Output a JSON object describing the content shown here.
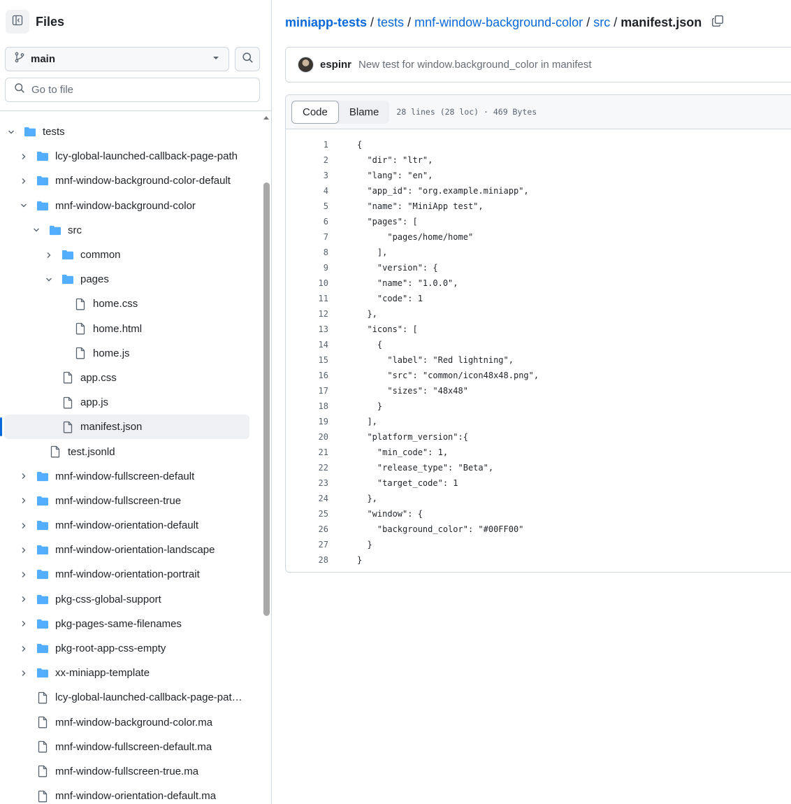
{
  "sidebar": {
    "title": "Files",
    "branch": "main",
    "goto_placeholder": "Go to file",
    "tree": [
      {
        "name": "tests",
        "type": "folder",
        "depth": 0,
        "expanded": true
      },
      {
        "name": "lcy-global-launched-callback-page-path",
        "type": "folder",
        "depth": 1,
        "expanded": false
      },
      {
        "name": "mnf-window-background-color-default",
        "type": "folder",
        "depth": 1,
        "expanded": false
      },
      {
        "name": "mnf-window-background-color",
        "type": "folder",
        "depth": 1,
        "expanded": true
      },
      {
        "name": "src",
        "type": "folder",
        "depth": 2,
        "expanded": true
      },
      {
        "name": "common",
        "type": "folder",
        "depth": 3,
        "expanded": false
      },
      {
        "name": "pages",
        "type": "folder",
        "depth": 3,
        "expanded": true
      },
      {
        "name": "home.css",
        "type": "file",
        "depth": 4
      },
      {
        "name": "home.html",
        "type": "file",
        "depth": 4
      },
      {
        "name": "home.js",
        "type": "file",
        "depth": 4
      },
      {
        "name": "app.css",
        "type": "file",
        "depth": 3
      },
      {
        "name": "app.js",
        "type": "file",
        "depth": 3
      },
      {
        "name": "manifest.json",
        "type": "file",
        "depth": 3,
        "active": true
      },
      {
        "name": "test.jsonld",
        "type": "file",
        "depth": 2
      },
      {
        "name": "mnf-window-fullscreen-default",
        "type": "folder",
        "depth": 1,
        "expanded": false
      },
      {
        "name": "mnf-window-fullscreen-true",
        "type": "folder",
        "depth": 1,
        "expanded": false
      },
      {
        "name": "mnf-window-orientation-default",
        "type": "folder",
        "depth": 1,
        "expanded": false
      },
      {
        "name": "mnf-window-orientation-landscape",
        "type": "folder",
        "depth": 1,
        "expanded": false
      },
      {
        "name": "mnf-window-orientation-portrait",
        "type": "folder",
        "depth": 1,
        "expanded": false
      },
      {
        "name": "pkg-css-global-support",
        "type": "folder",
        "depth": 1,
        "expanded": false
      },
      {
        "name": "pkg-pages-same-filenames",
        "type": "folder",
        "depth": 1,
        "expanded": false
      },
      {
        "name": "pkg-root-app-css-empty",
        "type": "folder",
        "depth": 1,
        "expanded": false
      },
      {
        "name": "xx-miniapp-template",
        "type": "folder",
        "depth": 1,
        "expanded": false
      },
      {
        "name": "lcy-global-launched-callback-page-pat…",
        "type": "file",
        "depth": 1
      },
      {
        "name": "mnf-window-background-color.ma",
        "type": "file",
        "depth": 1
      },
      {
        "name": "mnf-window-fullscreen-default.ma",
        "type": "file",
        "depth": 1
      },
      {
        "name": "mnf-window-fullscreen-true.ma",
        "type": "file",
        "depth": 1
      },
      {
        "name": "mnf-window-orientation-default.ma",
        "type": "file",
        "depth": 1
      }
    ]
  },
  "breadcrumb": {
    "root": "miniapp-tests",
    "parts": [
      "tests",
      "mnf-window-background-color",
      "src"
    ],
    "separator": "/",
    "current": "manifest.json"
  },
  "commit": {
    "author": "espinr",
    "message": "New test for window.background_color in manifest"
  },
  "file": {
    "tabs": [
      "Code",
      "Blame"
    ],
    "active_tab": "Code",
    "meta": "28 lines (28 loc) · 469 Bytes",
    "lines": [
      "{",
      "  \"dir\": \"ltr\",",
      "  \"lang\": \"en\",",
      "  \"app_id\": \"org.example.miniapp\",",
      "  \"name\": \"MiniApp test\",",
      "  \"pages\": [",
      "      \"pages/home/home\"",
      "    ],",
      "    \"version\": {",
      "    \"name\": \"1.0.0\",",
      "    \"code\": 1",
      "  },",
      "  \"icons\": [",
      "    {",
      "      \"label\": \"Red lightning\",",
      "      \"src\": \"common/icon48x48.png\",",
      "      \"sizes\": \"48x48\"",
      "    }",
      "  ],",
      "  \"platform_version\":{",
      "    \"min_code\": 1,",
      "    \"release_type\": \"Beta\",",
      "    \"target_code\": 1",
      "  },",
      "  \"window\": {",
      "    \"background_color\": \"#00FF00\"",
      "  }",
      "}"
    ]
  },
  "icons": {
    "panel": "sidebar-collapse-icon",
    "branch": "git-branch-icon",
    "dropdown": "triangle-down-icon",
    "search": "search-icon",
    "folder": "folder-icon",
    "file": "file-icon",
    "chevron_right": "chevron-right-icon",
    "chevron_down": "chevron-down-icon",
    "copy": "copy-icon"
  },
  "colors": {
    "link": "#0969da",
    "folder": "#54aeff",
    "text": "#1f2328",
    "muted": "#656d76",
    "border": "#d0d7de",
    "active_marker": "#0969da"
  }
}
